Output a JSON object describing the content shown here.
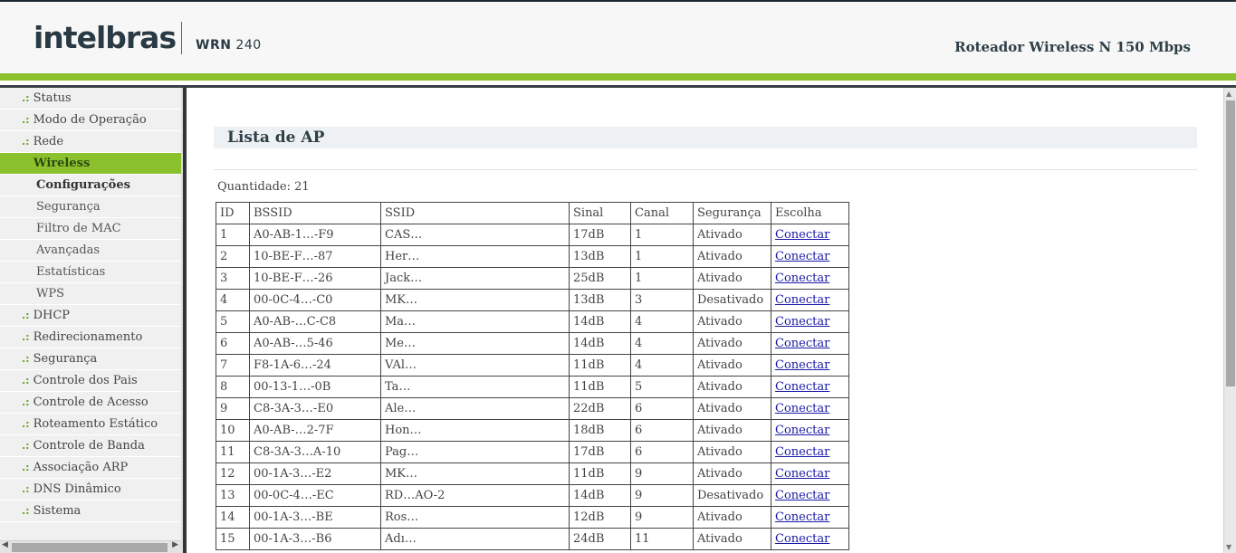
{
  "header": {
    "logo": "intelbras",
    "model_prefix": "WRN",
    "model_number": "240",
    "product": "Roteador Wireless N 150 Mbps"
  },
  "sidebar": {
    "items": [
      {
        "label": "Status",
        "type": "main"
      },
      {
        "label": "Modo de Operação",
        "type": "main"
      },
      {
        "label": "Rede",
        "type": "main"
      },
      {
        "label": "Wireless",
        "type": "active"
      },
      {
        "label": "Configurações",
        "type": "sub-selected"
      },
      {
        "label": "Segurança",
        "type": "sub"
      },
      {
        "label": "Filtro de MAC",
        "type": "sub"
      },
      {
        "label": "Avançadas",
        "type": "sub"
      },
      {
        "label": "Estatísticas",
        "type": "sub"
      },
      {
        "label": "WPS",
        "type": "sub"
      },
      {
        "label": "DHCP",
        "type": "main"
      },
      {
        "label": "Redirecionamento",
        "type": "main"
      },
      {
        "label": "Segurança",
        "type": "main"
      },
      {
        "label": "Controle dos Pais",
        "type": "main"
      },
      {
        "label": "Controle de Acesso",
        "type": "main"
      },
      {
        "label": "Roteamento Estático",
        "type": "main"
      },
      {
        "label": "Controle de Banda",
        "type": "main"
      },
      {
        "label": "Associação ARP",
        "type": "main"
      },
      {
        "label": "DNS Dinâmico",
        "type": "main"
      },
      {
        "label": "Sistema",
        "type": "main"
      }
    ],
    "bullet": ".:"
  },
  "main": {
    "title": "Lista de AP",
    "quantity": "Quantidade: 21",
    "columns": [
      "ID",
      "BSSID",
      "SSID",
      "Sinal",
      "Canal",
      "Segurança",
      "Escolha"
    ],
    "rows": [
      [
        "1",
        "A0-AB-1…-F9",
        "CAS…",
        "17dB",
        "1",
        "Ativado",
        "Conectar"
      ],
      [
        "2",
        "10-BE-F…-87",
        "Her…",
        "13dB",
        "1",
        "Ativado",
        "Conectar"
      ],
      [
        "3",
        "10-BE-F…-26",
        "Jack…",
        "25dB",
        "1",
        "Ativado",
        "Conectar"
      ],
      [
        "4",
        "00-0C-4…-C0",
        "MK…",
        "13dB",
        "3",
        "Desativado",
        "Conectar"
      ],
      [
        "5",
        "A0-AB-…C-C8",
        "Ma…",
        "14dB",
        "4",
        "Ativado",
        "Conectar"
      ],
      [
        "6",
        "A0-AB-…5-46",
        "Me…",
        "14dB",
        "4",
        "Ativado",
        "Conectar"
      ],
      [
        "7",
        "F8-1A-6…-24",
        "VAl…",
        "11dB",
        "4",
        "Ativado",
        "Conectar"
      ],
      [
        "8",
        "00-13-1…-0B",
        "Ta…",
        "11dB",
        "5",
        "Ativado",
        "Conectar"
      ],
      [
        "9",
        "C8-3A-3…-E0",
        "Ale…",
        "22dB",
        "6",
        "Ativado",
        "Conectar"
      ],
      [
        "10",
        "A0-AB-…2-7F",
        "Hon…",
        "18dB",
        "6",
        "Ativado",
        "Conectar"
      ],
      [
        "11",
        "C8-3A-3…A-10",
        "Pag…",
        "17dB",
        "6",
        "Ativado",
        "Conectar"
      ],
      [
        "12",
        "00-1A-3…-E2",
        "MK…",
        "11dB",
        "9",
        "Ativado",
        "Conectar"
      ],
      [
        "13",
        "00-0C-4…-EC",
        "RD…AO-2",
        "14dB",
        "9",
        "Desativado",
        "Conectar"
      ],
      [
        "14",
        "00-1A-3…-BE",
        "Ros…",
        "12dB",
        "9",
        "Ativado",
        "Conectar"
      ],
      [
        "15",
        "00-1A-3…-B6",
        "Adı…",
        "24dB",
        "11",
        "Ativado",
        "Conectar"
      ]
    ]
  },
  "colors": {
    "brand_green": "#8bc12c",
    "header_text": "#2a3a44",
    "link": "#1a1aa6"
  },
  "icons": {
    "scroll_up": "▲",
    "scroll_down": "▼",
    "scroll_left": "◀",
    "scroll_right": "▶"
  }
}
